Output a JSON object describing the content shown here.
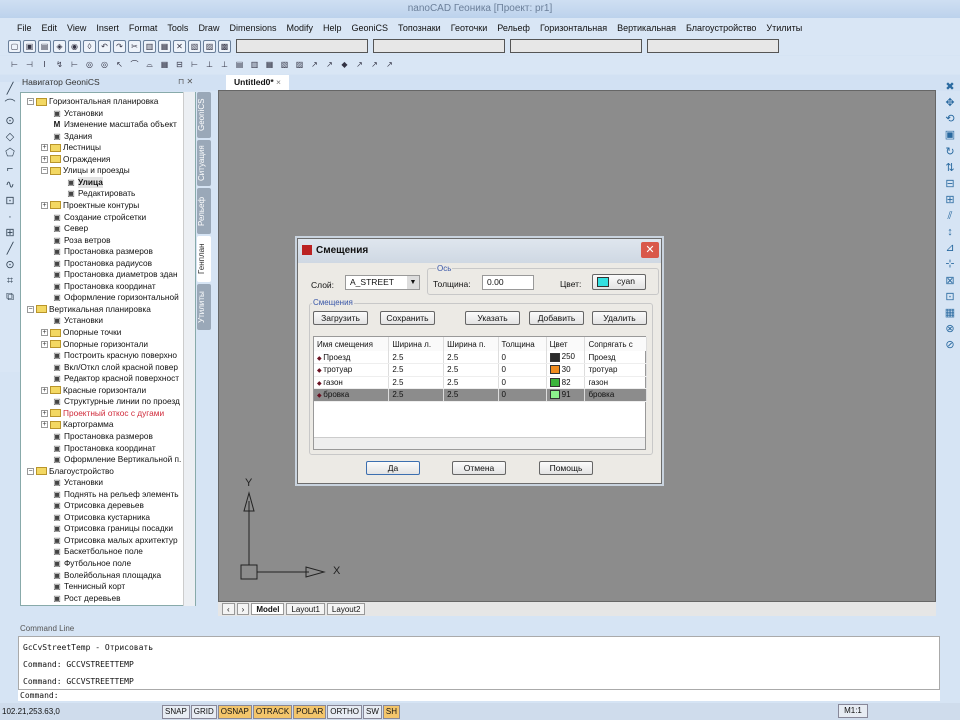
{
  "window": {
    "title": "nanoCAD Геоника [Проект: pr1]"
  },
  "menu": [
    "File",
    "Edit",
    "View",
    "Insert",
    "Format",
    "Tools",
    "Draw",
    "Dimensions",
    "Modify",
    "Help",
    "GeoniCS",
    "Топознаки",
    "Геоточки",
    "Рельеф",
    "Горизонтальная",
    "Вертикальная",
    "Благоустройство",
    "Утилиты"
  ],
  "panel": {
    "navigator_title": "Навигатор GeoniCS",
    "doc_tab": "Untitled0*"
  },
  "vtabs": [
    "GeoniCS",
    "Ситуация",
    "Рельеф",
    "Генплан",
    "Утилиты"
  ],
  "tree": [
    {
      "label": "Горизонтальная планировка",
      "level": 0,
      "type": "folder",
      "exp": "-"
    },
    {
      "label": "Установки",
      "level": 1,
      "type": "cmd"
    },
    {
      "label": "Изменение масштаба объект",
      "level": 1,
      "type": "cmd",
      "icon": "M"
    },
    {
      "label": "Здания",
      "level": 1,
      "type": "cmd"
    },
    {
      "label": "Лестницы",
      "level": 1,
      "type": "folder",
      "exp": "+"
    },
    {
      "label": "Ограждения",
      "level": 1,
      "type": "folder",
      "exp": "+"
    },
    {
      "label": "Улицы и проезды",
      "level": 1,
      "type": "folder",
      "exp": "-"
    },
    {
      "label": "Улица",
      "level": 2,
      "type": "cmd",
      "bold": true
    },
    {
      "label": "Редактировать",
      "level": 2,
      "type": "cmd"
    },
    {
      "label": "Проектные контуры",
      "level": 1,
      "type": "folder",
      "exp": "+"
    },
    {
      "label": "Создание стройсетки",
      "level": 1,
      "type": "cmd"
    },
    {
      "label": "Север",
      "level": 1,
      "type": "cmd"
    },
    {
      "label": "Роза ветров",
      "level": 1,
      "type": "cmd"
    },
    {
      "label": "Простановка размеров",
      "level": 1,
      "type": "cmd"
    },
    {
      "label": "Простановка радиусов",
      "level": 1,
      "type": "cmd"
    },
    {
      "label": "Простановка диаметров здан",
      "level": 1,
      "type": "cmd"
    },
    {
      "label": "Простановка координат",
      "level": 1,
      "type": "cmd"
    },
    {
      "label": "Оформление горизонтальной",
      "level": 1,
      "type": "cmd"
    },
    {
      "label": "Вертикальная планировка",
      "level": 0,
      "type": "folder",
      "exp": "-"
    },
    {
      "label": "Установки",
      "level": 1,
      "type": "cmd"
    },
    {
      "label": "Опорные точки",
      "level": 1,
      "type": "folder",
      "exp": "+"
    },
    {
      "label": "Опорные горизонтали",
      "level": 1,
      "type": "folder",
      "exp": "+"
    },
    {
      "label": "Построить красную поверхно",
      "level": 1,
      "type": "cmd"
    },
    {
      "label": "Вкл/Откл слой красной повер",
      "level": 1,
      "type": "cmd"
    },
    {
      "label": "Редактор красной поверхност",
      "level": 1,
      "type": "cmd"
    },
    {
      "label": "Красные горизонтали",
      "level": 1,
      "type": "folder",
      "exp": "+"
    },
    {
      "label": "Структурные линии по проезд",
      "level": 1,
      "type": "cmd"
    },
    {
      "label": "Проектный откос с дугами",
      "level": 1,
      "type": "folder",
      "exp": "+",
      "red": true
    },
    {
      "label": "Картограмма",
      "level": 1,
      "type": "folder",
      "exp": "+"
    },
    {
      "label": "Простановка размеров",
      "level": 1,
      "type": "cmd"
    },
    {
      "label": "Простановка координат",
      "level": 1,
      "type": "cmd"
    },
    {
      "label": "Оформление Вертикальной п.",
      "level": 1,
      "type": "cmd"
    },
    {
      "label": "Благоустройство",
      "level": 0,
      "type": "folder",
      "exp": "-"
    },
    {
      "label": "Установки",
      "level": 1,
      "type": "cmd"
    },
    {
      "label": "Поднять на рельеф элементь",
      "level": 1,
      "type": "cmd"
    },
    {
      "label": "Отрисовка деревьев",
      "level": 1,
      "type": "cmd"
    },
    {
      "label": "Отрисовка кустарника",
      "level": 1,
      "type": "cmd"
    },
    {
      "label": "Отрисовка границы посадки",
      "level": 1,
      "type": "cmd"
    },
    {
      "label": "Отрисовка малых архитектур",
      "level": 1,
      "type": "cmd"
    },
    {
      "label": "Баскетбольное поле",
      "level": 1,
      "type": "cmd"
    },
    {
      "label": "Футбольное поле",
      "level": 1,
      "type": "cmd"
    },
    {
      "label": "Волейбольная площадка",
      "level": 1,
      "type": "cmd"
    },
    {
      "label": "Теннисный корт",
      "level": 1,
      "type": "cmd"
    },
    {
      "label": "Рост деревьев",
      "level": 1,
      "type": "cmd"
    }
  ],
  "ucs": {
    "x": "X",
    "y": "Y"
  },
  "layout_tabs": [
    "Model",
    "Layout1",
    "Layout2"
  ],
  "dialog": {
    "title": "Смещения",
    "layer_label": "Слой:",
    "layer_value": "A_STREET",
    "axis_group": "Ось",
    "thickness_label": "Толщина:",
    "thickness_value": "0.00",
    "color_label": "Цвет:",
    "color_value": "cyan",
    "color_hex": "#33e0e0",
    "offsets_group": "Смещения",
    "buttons": {
      "load": "Загрузить",
      "save": "Сохранить",
      "pick": "Указать",
      "add": "Добавить",
      "delete": "Удалить",
      "ok": "Да",
      "cancel": "Отмена",
      "help": "Помощь"
    },
    "columns": [
      "Имя смещения",
      "Ширина л.",
      "Ширина п.",
      "Толщина",
      "Цвет",
      "Сопрягать с"
    ],
    "rows": [
      {
        "name": "Проезд",
        "wl": "2.5",
        "wr": "2.5",
        "th": "0",
        "color": "250",
        "hex": "#2a2a2a",
        "join": "Проезд"
      },
      {
        "name": "тротуар",
        "wl": "2.5",
        "wr": "2.5",
        "th": "0",
        "color": "30",
        "hex": "#f08c1e",
        "join": "тротуар"
      },
      {
        "name": "газон",
        "wl": "2.5",
        "wr": "2.5",
        "th": "0",
        "color": "82",
        "hex": "#3cb43c",
        "join": "газон"
      },
      {
        "name": "бровка",
        "wl": "2.5",
        "wr": "2.5",
        "th": "0",
        "color": "91",
        "hex": "#8cf08c",
        "join": "бровка",
        "selected": true
      }
    ]
  },
  "command": {
    "header": "Command Line",
    "lines": [
      "GcCvStreetTemp - Отрисовать",
      "Command: GCCVSTREETTEMP",
      "Command: GCCVSTREETTEMP"
    ],
    "prompt": "Command:"
  },
  "status": {
    "coords": "102.21,253.63,0",
    "buttons": [
      {
        "label": "SNAP",
        "on": false
      },
      {
        "label": "GRID",
        "on": false
      },
      {
        "label": "OSNAP",
        "on": true
      },
      {
        "label": "OTRACK",
        "on": true
      },
      {
        "label": "POLAR",
        "on": true
      },
      {
        "label": "ORTHO",
        "on": false
      },
      {
        "label": "SW",
        "on": false
      },
      {
        "label": "SH",
        "on": true
      }
    ],
    "scale": "M1:1"
  }
}
